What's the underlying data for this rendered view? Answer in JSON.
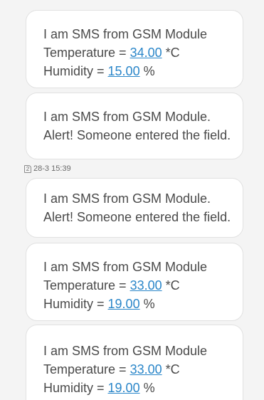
{
  "messages": [
    {
      "type": "reading",
      "line1": "I am SMS from GSM Module",
      "temp_label": "Temperature = ",
      "temp_value": "34.00",
      "temp_unit": " *C",
      "hum_label": "Humidity = ",
      "hum_value": "15.00",
      "hum_unit": " %"
    },
    {
      "type": "alert",
      "line1": "I am SMS from GSM Module.",
      "line2": "Alert! Someone entered the field."
    },
    {
      "type": "alert",
      "line1": "I am SMS from GSM Module.",
      "line2": "Alert! Someone entered the field."
    },
    {
      "type": "reading",
      "line1": "I am SMS from GSM Module",
      "temp_label": "Temperature = ",
      "temp_value": "33.00",
      "temp_unit": " *C",
      "hum_label": "Humidity = ",
      "hum_value": "19.00",
      "hum_unit": " %"
    },
    {
      "type": "reading",
      "line1": "I am SMS from GSM Module",
      "temp_label": "Temperature = ",
      "temp_value": "33.00",
      "temp_unit": " *C",
      "hum_label": "Humidity = ",
      "hum_value": "19.00",
      "hum_unit": " %"
    }
  ],
  "timestamp": {
    "sim_icon": "sim-2-icon",
    "sim_number": "2",
    "time": "28-3 15:39"
  },
  "colors": {
    "link": "#2a86c9",
    "text": "#4a4a4a",
    "bubble": "#ffffff",
    "background": "#f4f4f4"
  }
}
